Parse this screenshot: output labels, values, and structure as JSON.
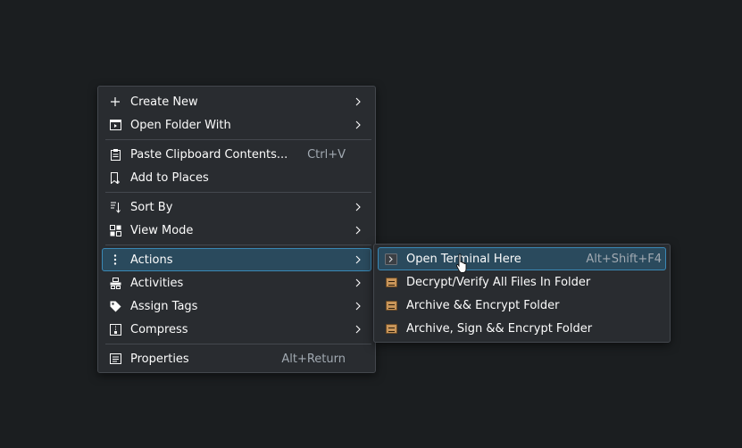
{
  "context_menu": {
    "items": [
      {
        "label": "Create New",
        "icon": "plus-icon",
        "submenu": true
      },
      {
        "label": "Open Folder With",
        "icon": "open-with-icon",
        "submenu": true
      },
      {
        "label": "Paste Clipboard Contents...",
        "icon": "clipboard-icon",
        "shortcut": "Ctrl+V"
      },
      {
        "label": "Add to Places",
        "icon": "bookmark-add-icon"
      },
      {
        "label": "Sort By",
        "icon": "sort-icon",
        "submenu": true
      },
      {
        "label": "View Mode",
        "icon": "view-mode-icon",
        "submenu": true
      },
      {
        "label": "Actions",
        "icon": "more-vertical-icon",
        "submenu": true,
        "highlighted": true
      },
      {
        "label": "Activities",
        "icon": "activities-icon",
        "submenu": true
      },
      {
        "label": "Assign Tags",
        "icon": "tag-icon",
        "submenu": true
      },
      {
        "label": "Compress",
        "icon": "compress-icon",
        "submenu": true
      },
      {
        "label": "Properties",
        "icon": "properties-icon",
        "shortcut": "Alt+Return"
      }
    ]
  },
  "actions_submenu": {
    "items": [
      {
        "label": "Open Terminal Here",
        "icon": "terminal-icon",
        "shortcut": "Alt+Shift+F4",
        "highlighted": true
      },
      {
        "label": "Decrypt/Verify All Files In Folder",
        "icon": "kleopatra-icon"
      },
      {
        "label": "Archive && Encrypt Folder",
        "icon": "kleopatra-icon"
      },
      {
        "label": "Archive, Sign && Encrypt Folder",
        "icon": "kleopatra-icon"
      }
    ]
  },
  "colors": {
    "background": "#1b1e20",
    "menu": "#292c30",
    "highlight": "#2a4a5d",
    "highlight_border": "#3a88b5",
    "shortcut_text": "#a1a9b1"
  }
}
